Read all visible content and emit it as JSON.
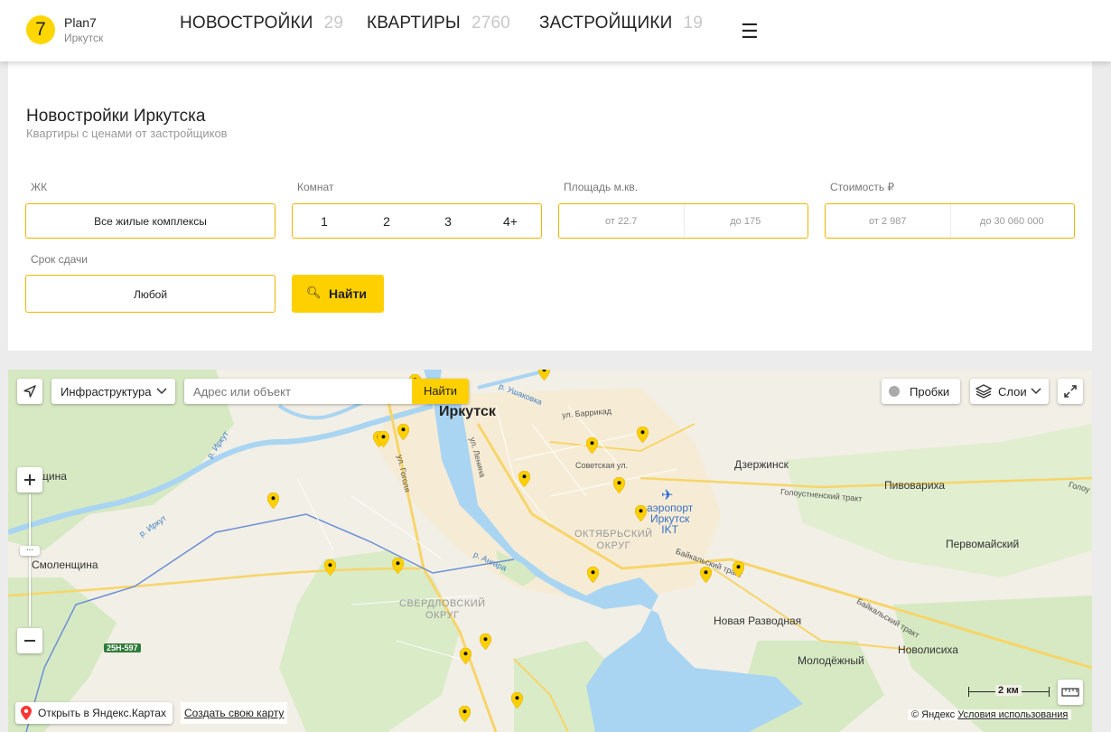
{
  "header": {
    "logo_digit": "7",
    "logo_name": "Plan7",
    "logo_city": "Иркутск",
    "nav": [
      {
        "label": "НОВОСТРОЙКИ",
        "count": "29"
      },
      {
        "label": "КВАРТИРЫ",
        "count": "2760"
      },
      {
        "label": "ЗАСТРОЙЩИКИ",
        "count": "19"
      }
    ],
    "menu_icon": "☰"
  },
  "filters": {
    "title": "Новостройки Иркутска",
    "subtitle": "Квартиры с ценами от застройщиков",
    "complex_label": "ЖК",
    "complex_value": "Все жилые комплексы",
    "rooms_label": "Комнат",
    "rooms": [
      "1",
      "2",
      "3",
      "4+"
    ],
    "area_label": "Площадь м.кв.",
    "area_from": "от 22.7",
    "area_to": "до 175",
    "price_label": "Стоимость ₽",
    "price_from": "от 2 987",
    "price_to": "до 30 060 000",
    "deadline_label": "Срок сдачи",
    "deadline_value": "Любой",
    "search_label": "Найти"
  },
  "map": {
    "infra_label": "Инфраструктура",
    "address_placeholder": "Адрес или объект",
    "search_label": "Найти",
    "traffic_label": "Пробки",
    "layers_label": "Слои",
    "open_yandex": "Открыть в Яндекс.Картах",
    "create_map": "Создать свою карту",
    "copyright": "© Яндекс",
    "terms": "Условия использования",
    "scale": "2 км",
    "places": {
      "irkutsk": "Иркутск",
      "dzerzhinsk": "Дзержинск",
      "pivovarikha": "Пивовариха",
      "pervomaysky": "Первомайский",
      "smolenshchina": "Смоленщина",
      "shchina": "щина",
      "nova_razvodnaya": "Новая Разводная",
      "molodezhny": "Молодёжный",
      "novolisikha": "Новолисиха",
      "airport": "аэропорт\nИркутск\nIKT",
      "oktyabrsky": "ОКТЯБРЬСКИЙ\nОКРУГ",
      "sverdlovsky": "СВЕРДЛОВСКИЙ\nОКРУГ"
    },
    "roads": {
      "ushakovka": "р. Ушаковка",
      "barrikad": "ул. Баррикад",
      "lenina": "ул. Ленина",
      "sovetskaya": "Советская ул.",
      "golousnenskiy": "Голоустненский тракт",
      "baikalsky1": "Байкальский тракт",
      "baikalsky2": "Байкальский тракт",
      "irkut1": "р. Иркут",
      "irkut2": "р. Иркут",
      "gogolya": "ул. Гоголя",
      "angara": "р. Ангара",
      "golou": "Голоу",
      "route_25n": "25Н-597"
    }
  },
  "colors": {
    "accent": "#ffd000",
    "border": "#f0b400",
    "water": "#a9d5f2",
    "green": "#d4e8c0"
  }
}
